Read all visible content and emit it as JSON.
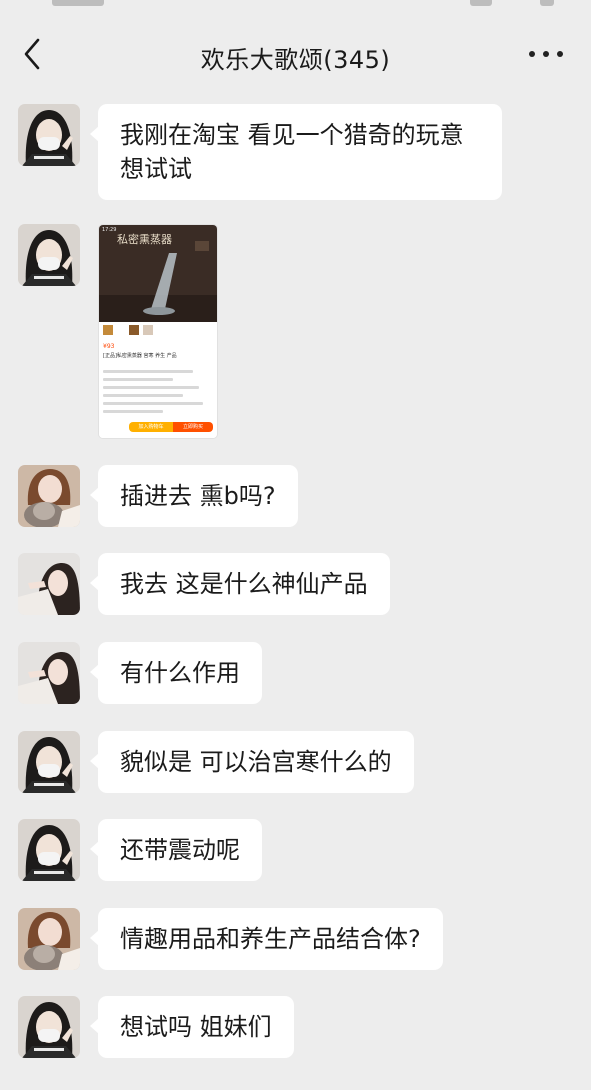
{
  "nav": {
    "title": "欢乐大歌颂(345)"
  },
  "messages": [
    {
      "avatar": "girl-mask-avatar",
      "text": "我刚在淘宝 看见一个猎奇的玩意 想试试"
    },
    {
      "avatar": "girl-mask-avatar",
      "type": "image",
      "image": {
        "title": "私密熏蒸器",
        "time": "17:29",
        "price": "¥93",
        "desc": "[正品]私密熏蒸器 宫寒 养生 产品",
        "btn_cart": "加入购物车",
        "btn_buy": "立即购买"
      }
    },
    {
      "avatar": "girl-cat-avatar",
      "text": "插进去 熏b吗?"
    },
    {
      "avatar": "girl-lying-avatar",
      "text": "我去 这是什么神仙产品"
    },
    {
      "avatar": "girl-lying-avatar",
      "text": "有什么作用"
    },
    {
      "avatar": "girl-mask-avatar",
      "text": "貌似是 可以治宫寒什么的"
    },
    {
      "avatar": "girl-mask-avatar",
      "text": "还带震动呢"
    },
    {
      "avatar": "girl-cat-avatar",
      "text": "情趣用品和养生产品结合体?"
    },
    {
      "avatar": "girl-mask-avatar",
      "text": "想试吗 姐妹们"
    }
  ]
}
